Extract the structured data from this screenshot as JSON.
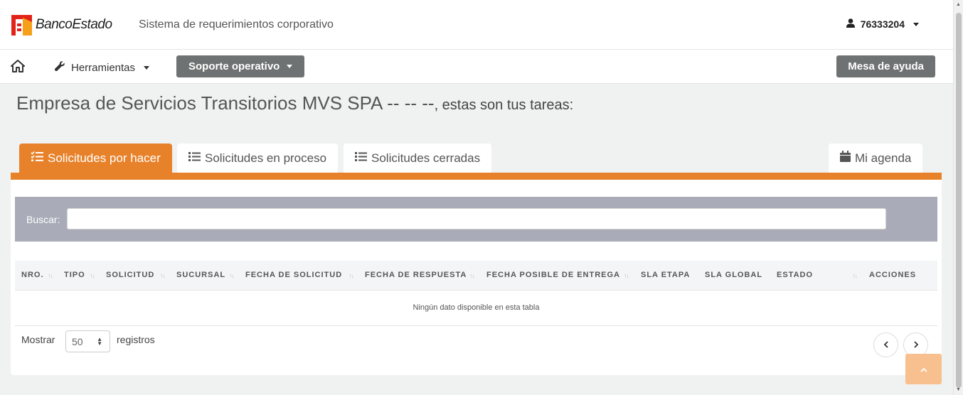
{
  "header": {
    "brand": "BancoEstado",
    "app_title": "Sistema de requerimientos corporativo",
    "user": "76333204"
  },
  "nav": {
    "tools_label": "Herramientas",
    "support_label": "Soporte operativo",
    "help_label": "Mesa de ayuda"
  },
  "page": {
    "company": "Empresa de Servicios Transitorios MVS SPA -- -- --",
    "tasks_suffix": ", estas son tus tareas:"
  },
  "tabs": [
    {
      "label": "Solicitudes por hacer",
      "active": true
    },
    {
      "label": "Solicitudes en proceso",
      "active": false
    },
    {
      "label": "Solicitudes cerradas",
      "active": false
    },
    {
      "label": "Mi agenda",
      "active": false
    }
  ],
  "search": {
    "label": "Buscar:",
    "value": ""
  },
  "table": {
    "columns": [
      "NRO.",
      "TIPO",
      "SOLICITUD",
      "SUCURSAL",
      "FECHA DE SOLICITUD",
      "FECHA DE RESPUESTA",
      "FECHA POSIBLE DE ENTREGA",
      "SLA ETAPA",
      "SLA GLOBAL",
      "ESTADO",
      "ACCIONES"
    ],
    "empty_message": "Ningún dato disponible en esta tabla"
  },
  "length": {
    "show_label": "Mostrar",
    "value": "50",
    "records_label": "registros"
  },
  "colors": {
    "accent": "#e8822a",
    "gray_button": "#6f7272",
    "search_bg": "#a9acb8"
  },
  "icons": [
    "home-icon",
    "wrench-icon",
    "user-icon",
    "tasks-icon",
    "list-icon",
    "calendar-icon",
    "chevron-left-icon",
    "chevron-right-icon",
    "chevron-up-icon"
  ]
}
